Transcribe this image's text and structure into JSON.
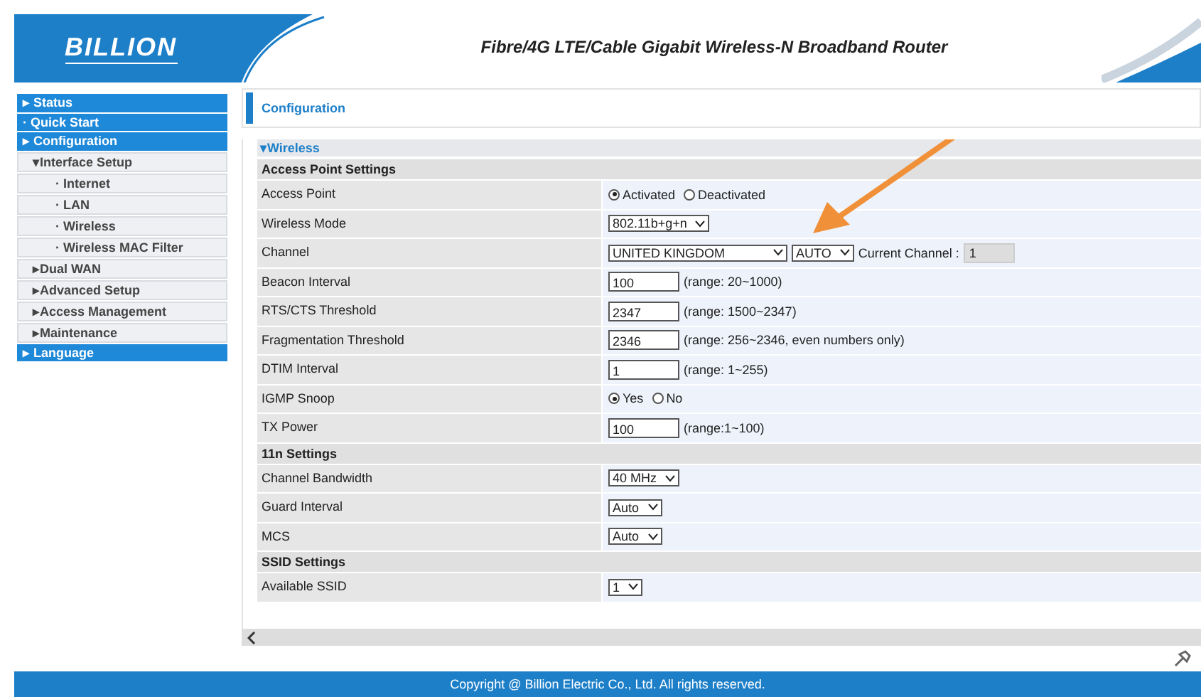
{
  "header": {
    "logo": "BILLION",
    "title": "Fibre/4G LTE/Cable Gigabit Wireless-N Broadband Router"
  },
  "sidebar": {
    "items": [
      {
        "label": "Status",
        "marker": "▸"
      },
      {
        "label": "Quick Start",
        "marker": "·"
      },
      {
        "label": "Configuration",
        "marker": "▸",
        "children": [
          {
            "label": "Interface Setup",
            "marker": "▾",
            "children": [
              {
                "label": "Internet",
                "marker": "·"
              },
              {
                "label": "LAN",
                "marker": "·"
              },
              {
                "label": "Wireless",
                "marker": "·"
              },
              {
                "label": "Wireless MAC Filter",
                "marker": "·"
              }
            ]
          },
          {
            "label": "Dual WAN",
            "marker": "▸"
          },
          {
            "label": "Advanced Setup",
            "marker": "▸"
          },
          {
            "label": "Access Management",
            "marker": "▸"
          },
          {
            "label": "Maintenance",
            "marker": "▸"
          }
        ]
      },
      {
        "label": "Language",
        "marker": "▸"
      }
    ]
  },
  "page_title": "Configuration",
  "section": {
    "label": "Wireless",
    "marker": "▾",
    "expanded": true
  },
  "rows": [
    {
      "kind": "heading",
      "label": "Access Point Settings"
    },
    {
      "kind": "radio",
      "label": "Access Point",
      "options": [
        {
          "label": "Activated",
          "selected": true
        },
        {
          "label": "Deactivated",
          "selected": false
        }
      ]
    },
    {
      "kind": "select",
      "label": "Wireless Mode",
      "value": "802.11b+g+n"
    },
    {
      "kind": "channel",
      "label": "Channel",
      "value": "UNITED KINGDOM",
      "channel": "AUTO",
      "current_label": "Current Channel :",
      "current_value": "1"
    },
    {
      "kind": "input",
      "label": "Beacon Interval",
      "value": "100",
      "hint": "(range: 20~1000)"
    },
    {
      "kind": "input",
      "label": "RTS/CTS Threshold",
      "value": "2347",
      "hint": "(range: 1500~2347)"
    },
    {
      "kind": "input",
      "label": "Fragmentation Threshold",
      "value": "2346",
      "hint": "(range: 256~2346, even numbers only)"
    },
    {
      "kind": "input",
      "label": "DTIM Interval",
      "value": "1",
      "hint": "(range: 1~255)"
    },
    {
      "kind": "radio",
      "label": "IGMP Snoop",
      "options": [
        {
          "label": "Yes",
          "selected": true
        },
        {
          "label": "No",
          "selected": false
        }
      ]
    },
    {
      "kind": "input",
      "label": "TX Power",
      "value": "100",
      "hint": "(range:1~100)"
    },
    {
      "kind": "heading",
      "label": "11n Settings"
    },
    {
      "kind": "select",
      "label": "Channel Bandwidth",
      "value": "40 MHz"
    },
    {
      "kind": "select",
      "label": "Guard Interval",
      "value": "Auto"
    },
    {
      "kind": "select",
      "label": "MCS",
      "value": "Auto"
    },
    {
      "kind": "heading",
      "label": "SSID Settings"
    },
    {
      "kind": "select",
      "label": "Available SSID",
      "value": "1"
    }
  ],
  "footer": "Copyright @ Billion Electric Co., Ltd. All rights reserved."
}
